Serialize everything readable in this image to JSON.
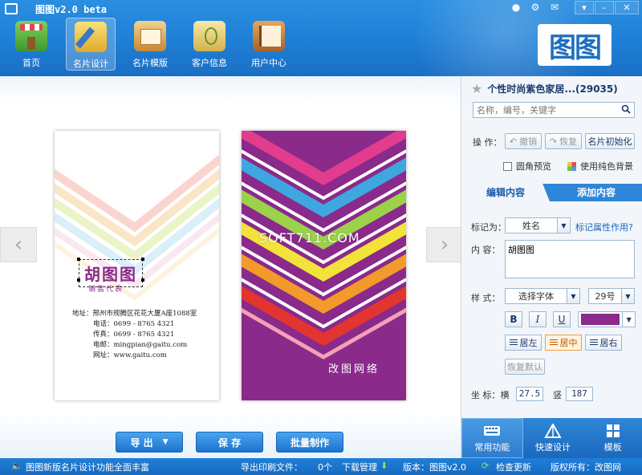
{
  "app": {
    "title": "图图v2.0 beta"
  },
  "nav": [
    {
      "label": "首页"
    },
    {
      "label": "名片设计"
    },
    {
      "label": "名片模版"
    },
    {
      "label": "客户信息"
    },
    {
      "label": "用户中心"
    }
  ],
  "logo_text": "图图",
  "card_front": {
    "name": "胡图图",
    "role": "销售代表",
    "address": "地址：邢州市规腾区花花大厦A座1088室",
    "phone": "电话：0699 - 8765 4321",
    "fax": "传真：0699 - 8765 4321",
    "email": "电邮：mingpian@gaitu.com",
    "web": "网址：www.gaitu.com"
  },
  "card_back": {
    "text": "改图网络"
  },
  "watermark": "SOFT711.COM",
  "actions": {
    "export": "导 出",
    "save": "保 存",
    "batch": "批量制作"
  },
  "panel": {
    "template_title": "个性时尚紫色家居...(29035)",
    "search_placeholder": "名称，编号，关键字",
    "op_label": "操  作：",
    "undo": "撤销",
    "redo": "恢复",
    "init": "名片初始化",
    "round_preview": "圆角预览",
    "solid_bg": "使用纯色背景",
    "tab_edit": "编辑内容",
    "tab_add": "添加内容",
    "mark_as_label": "标记为：",
    "mark_as_value": "姓名",
    "mark_link": "标记属性作用?",
    "content_label": "内  容：",
    "content_value": "胡图图",
    "style_label": "样  式：",
    "font_value": "选择字体",
    "size_value": "29号",
    "bold": "B",
    "italic": "I",
    "underline": "U",
    "text_color": "#8a2a8a",
    "align_left": "居左",
    "align_center": "居中",
    "align_right": "居右",
    "restore_default": "恢复默认",
    "coord_label": "坐  标：横",
    "coord_x": "27.5",
    "coord_v_label": "竖",
    "coord_y": "187",
    "bottom_tabs": [
      "常用功能",
      "快速设计",
      "模板"
    ]
  },
  "status": {
    "news": "图图新版名片设计功能全面丰富",
    "export_files_label": "导出印刷文件：",
    "export_files_count": "0个",
    "download": "下载管理",
    "version": "版本：图图v2.0",
    "update": "检查更新",
    "copyright": "版权所有：改图网"
  }
}
